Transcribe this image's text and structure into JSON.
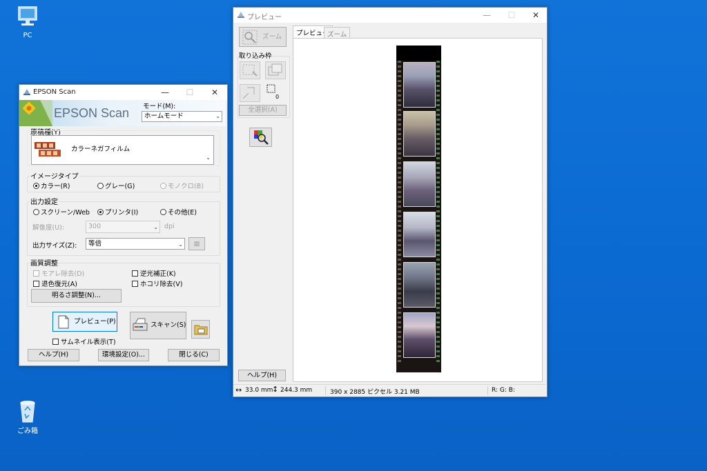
{
  "desktop": {
    "pc_label": "PC",
    "recycle_label": "ごみ箱"
  },
  "epson": {
    "title": "EPSON Scan",
    "banner_text": "EPSON Scan",
    "mode_label": "モード(M):",
    "mode_value": "ホームモード",
    "doc_type_label": "原稿種(Y)",
    "doc_type_value": "カラーネガフィルム",
    "image_type_label": "イメージタイプ",
    "image_type_options": [
      "カラー(R)",
      "グレー(G)",
      "モノクロ(B)"
    ],
    "output_label": "出力設定",
    "output_options": [
      "スクリーン/Web",
      "プリンタ(I)",
      "その他(E)"
    ],
    "resolution_label": "解像度(U):",
    "resolution_value": "300",
    "resolution_unit": "dpi",
    "output_size_label": "出力サイズ(Z):",
    "output_size_value": "等倍",
    "quality_label": "画質調整",
    "quality_checks": [
      "モアレ除去(D)",
      "逆光補正(K)",
      "退色復元(A)",
      "ホコリ除去(V)"
    ],
    "brightness_button": "明るさ調整(N)...",
    "preview_button": "プレビュー(P)",
    "scan_button": "スキャン(S)",
    "thumbnail_label": "サムネイル表示(T)",
    "help_button": "ヘルプ(H)",
    "config_button": "環境設定(O)...",
    "close_button": "閉じる(C)"
  },
  "preview": {
    "title": "プレビュー",
    "zoom_button": "ズーム",
    "marquee_label": "取り込み枠",
    "marquee_count": "0",
    "select_all_button": "全選択(A)",
    "help_button": "ヘルプ(H)",
    "tabs": [
      "プレビュー",
      "ズーム"
    ],
    "status_width": "33.0 mm",
    "status_height": "244.3 mm",
    "status_pixels": "390 x 2885 ピクセル 3.21 MB",
    "status_rgb": "R: G: B:"
  }
}
